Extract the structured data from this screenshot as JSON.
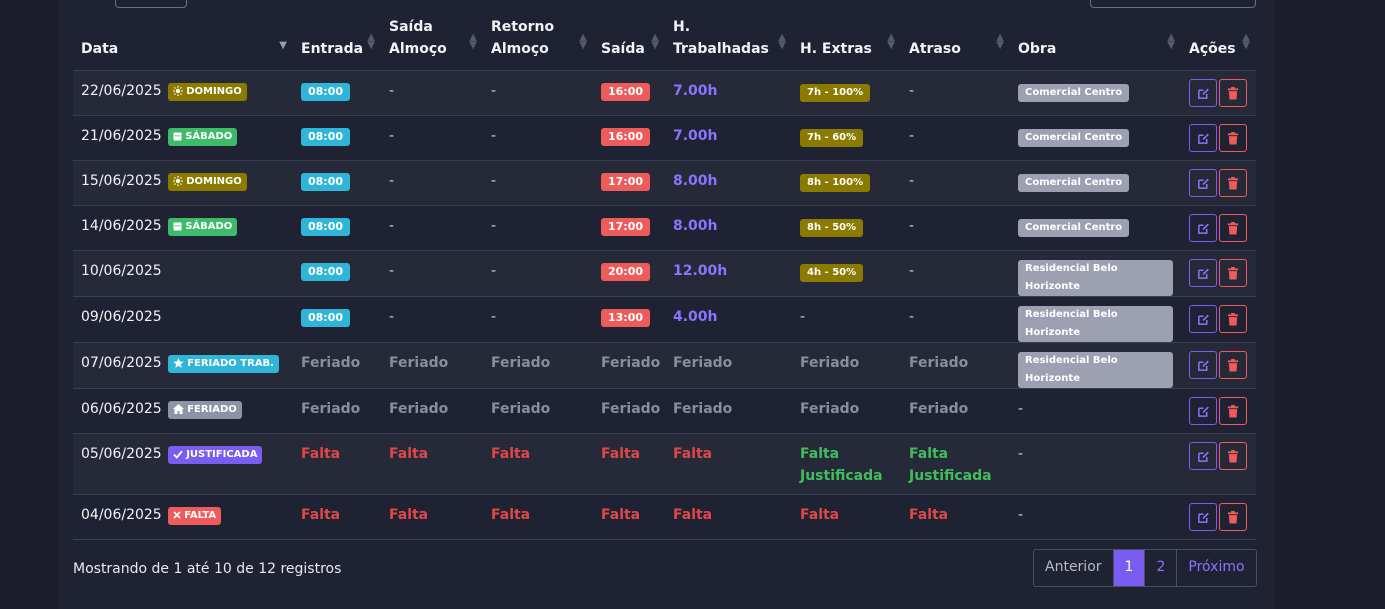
{
  "headers": {
    "data": "Data",
    "entrada": "Entrada",
    "saida_almoco_1": "Saída",
    "saida_almoco_2": "Almoço",
    "retorno_almoco_1": "Retorno",
    "retorno_almoco_2": "Almoço",
    "saida": "Saída",
    "h_trab_1": "H.",
    "h_trab_2": "Trabalhadas",
    "h_extras": "H. Extras",
    "atraso": "Atraso",
    "obra": "Obra",
    "acoes": "Ações"
  },
  "rows": [
    {
      "date": "22/06/2025",
      "badge": "DOMINGO",
      "badge_type": "sun",
      "entrada": "08:00",
      "saida_almoco": "-",
      "retorno_almoco": "-",
      "saida": "16:00",
      "horas": "7.00h",
      "extras": "7h - 100%",
      "atraso": "-",
      "obra": "Comercial Centro"
    },
    {
      "date": "21/06/2025",
      "badge": "SÁBADO",
      "badge_type": "sat",
      "entrada": "08:00",
      "saida_almoco": "-",
      "retorno_almoco": "-",
      "saida": "16:00",
      "horas": "7.00h",
      "extras": "7h - 60%",
      "atraso": "-",
      "obra": "Comercial Centro"
    },
    {
      "date": "15/06/2025",
      "badge": "DOMINGO",
      "badge_type": "sun",
      "entrada": "08:00",
      "saida_almoco": "-",
      "retorno_almoco": "-",
      "saida": "17:00",
      "horas": "8.00h",
      "extras": "8h - 100%",
      "atraso": "-",
      "obra": "Comercial Centro"
    },
    {
      "date": "14/06/2025",
      "badge": "SÁBADO",
      "badge_type": "sat",
      "entrada": "08:00",
      "saida_almoco": "-",
      "retorno_almoco": "-",
      "saida": "17:00",
      "horas": "8.00h",
      "extras": "8h - 50%",
      "atraso": "-",
      "obra": "Comercial Centro"
    },
    {
      "date": "10/06/2025",
      "entrada": "08:00",
      "saida_almoco": "-",
      "retorno_almoco": "-",
      "saida": "20:00",
      "horas": "12.00h",
      "extras": "4h - 50%",
      "atraso": "-",
      "obra": "Residencial Belo Horizonte"
    },
    {
      "date": "09/06/2025",
      "entrada": "08:00",
      "saida_almoco": "-",
      "retorno_almoco": "-",
      "saida": "13:00",
      "horas": "4.00h",
      "extras": "-",
      "atraso": "-",
      "obra": "Residencial Belo Horizonte"
    },
    {
      "date": "07/06/2025",
      "badge": "FERIADO TRAB.",
      "badge_type": "holw",
      "cell": "Feriado",
      "obra": "Residencial Belo Horizonte"
    },
    {
      "date": "06/06/2025",
      "badge": "FERIADO",
      "badge_type": "hol",
      "cell": "Feriado",
      "obra": "-"
    },
    {
      "date": "05/06/2025",
      "badge": "JUSTIFICADA",
      "badge_type": "just",
      "cell": "Falta",
      "justified_1": "Falta",
      "justified_2": "Justificada",
      "obra": "-"
    },
    {
      "date": "04/06/2025",
      "badge": "FALTA",
      "badge_type": "falta",
      "cell": "Falta",
      "obra": "-"
    }
  ],
  "footer": {
    "info": "Mostrando de 1 até 10 de 12 registros",
    "prev": "Anterior",
    "page1": "1",
    "page2": "2",
    "next": "Próximo"
  },
  "icons": {
    "sun": "sun-icon",
    "sat": "calendar-icon",
    "holw": "star-icon",
    "hol": "home-icon",
    "just": "check-icon",
    "falta": "x-icon"
  },
  "colors": {
    "accent": "#7b5cf0",
    "danger": "#ee5b5b",
    "info": "#2fb5d8",
    "success": "#3dbb6a",
    "warning": "#8a7a00"
  }
}
